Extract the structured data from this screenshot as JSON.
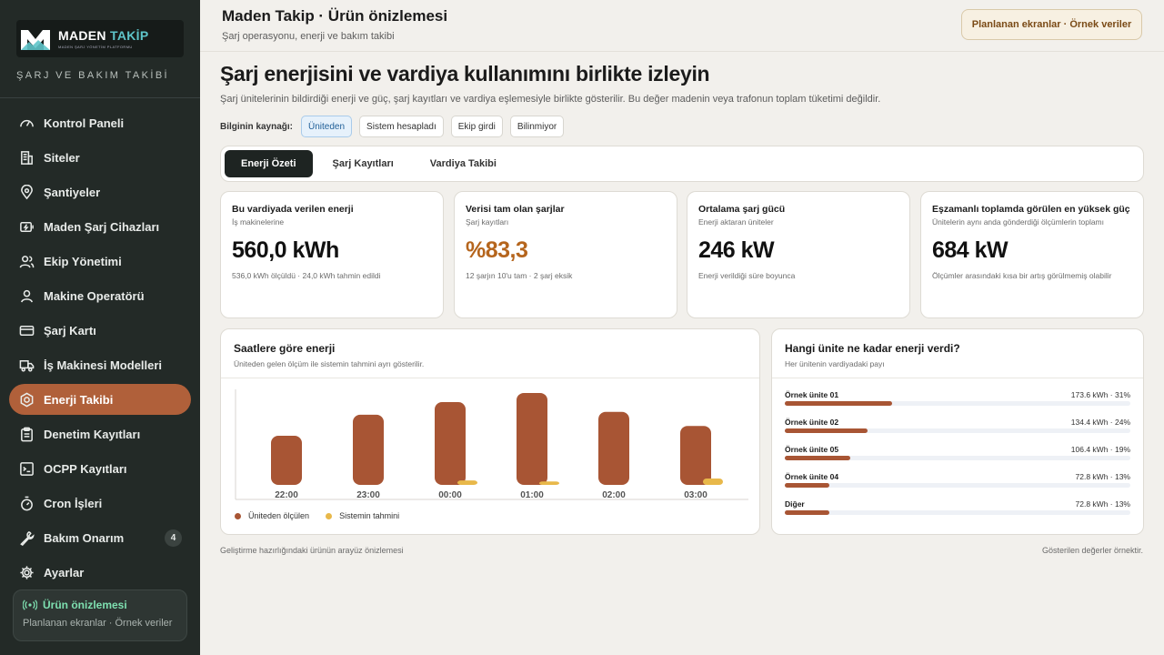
{
  "sidebar": {
    "logo_main": "MADEN",
    "logo_accent": "TAKİP",
    "logo_tagline": "MADEN ŞARJ YÖNETİM PLATFORMU",
    "subtitle": "ŞARJ VE BAKIM TAKİBİ",
    "items": [
      {
        "label": "Kontrol Paneli",
        "icon": "dashboard-icon"
      },
      {
        "label": "Siteler",
        "icon": "building-icon"
      },
      {
        "label": "Şantiyeler",
        "icon": "location-pin-icon"
      },
      {
        "label": "Maden Şarj Cihazları",
        "icon": "battery-charge-icon"
      },
      {
        "label": "Ekip Yönetimi",
        "icon": "team-icon"
      },
      {
        "label": "Makine Operatörü",
        "icon": "user-icon"
      },
      {
        "label": "Şarj Kartı",
        "icon": "card-icon"
      },
      {
        "label": "İş Makinesi Modelleri",
        "icon": "truck-icon"
      },
      {
        "label": "Enerji Takibi",
        "icon": "energy-hex-icon",
        "active": true
      },
      {
        "label": "Denetim Kayıtları",
        "icon": "clipboard-icon"
      },
      {
        "label": "OCPP Kayıtları",
        "icon": "terminal-icon"
      },
      {
        "label": "Cron İşleri",
        "icon": "stopwatch-icon"
      },
      {
        "label": "Bakım Onarım",
        "icon": "wrench-icon",
        "badge": "4"
      },
      {
        "label": "Ayarlar",
        "icon": "gear-icon"
      }
    ],
    "preview": {
      "title": "Ürün önizlemesi",
      "sub": "Planlanan ekranlar · Örnek veriler"
    }
  },
  "header": {
    "title": "Maden Takip · Ürün önizlemesi",
    "subtitle": "Şarj operasyonu, enerji ve bakım takibi",
    "pill": "Planlanan ekranlar · Örnek veriler"
  },
  "main": {
    "title": "Şarj enerjisini ve vardiya kullanımını birlikte izleyin",
    "description": "Şarj ünitelerinin bildirdiği enerji ve güç, şarj kayıtları ve vardiya eşlemesiyle birlikte gösterilir. Bu değer madenin veya trafonun toplam tüketimi değildir.",
    "source_label": "Bilginin kaynağı:",
    "sources": [
      "Üniteden",
      "Sistem hesapladı",
      "Ekip girdi",
      "Bilinmiyor"
    ],
    "tabs": [
      "Enerji Özeti",
      "Şarj Kayıtları",
      "Vardiya Takibi"
    ]
  },
  "kpis": [
    {
      "title": "Bu vardiyada verilen enerji",
      "sub": "İş makinelerine",
      "value": "560,0 kWh",
      "note": "536,0 kWh ölçüldü · 24,0 kWh tahmin edildi"
    },
    {
      "title": "Verisi tam olan şarjlar",
      "sub": "Şarj kayıtları",
      "value": "%83,3",
      "note": "12 şarjın 10'u tam · 2 şarj eksik"
    },
    {
      "title": "Ortalama şarj gücü",
      "sub": "Enerji aktaran üniteler",
      "value": "246 kW",
      "note": "Enerji verildiği süre boyunca"
    },
    {
      "title": "Eşzamanlı toplamda görülen en yüksek güç",
      "sub": "Ünitelerin aynı anda gönderdiği ölçümlerin toplamı",
      "value": "684 kW",
      "note": "Ölçümler arasındaki kısa bir artış görülmemiş olabilir"
    }
  ],
  "energy_panel": {
    "title": "Saatlere göre enerji",
    "sub": "Üniteden gelen ölçüm ile sistemin tahmini ayrı gösterilir.",
    "legend_measured": "Üniteden ölçülen",
    "legend_estimated": "Sistemin tahmini"
  },
  "units_panel": {
    "title": "Hangi ünite ne kadar enerji verdi?",
    "sub": "Her ünitenin vardiyadaki payı",
    "rows": [
      {
        "name": "Örnek ünite 01",
        "value": "173.6 kWh · 31%",
        "share": 0.31
      },
      {
        "name": "Örnek ünite 02",
        "value": "134.4 kWh · 24%",
        "share": 0.24
      },
      {
        "name": "Örnek ünite 05",
        "value": "106.4 kWh · 19%",
        "share": 0.19
      },
      {
        "name": "Örnek ünite 04",
        "value": "72.8 kWh · 13%",
        "share": 0.13
      },
      {
        "name": "Diğer",
        "value": "72.8 kWh · 13%",
        "share": 0.13
      }
    ]
  },
  "footer": {
    "left": "Geliştirme hazırlığındaki ürünün arayüz önizlemesi",
    "right": "Gösterilen değerler örnektir."
  },
  "colors": {
    "accent": "#b0603a",
    "measured": "#a85534",
    "estimated": "#e8b84a",
    "sidebar": "#232a27"
  },
  "chart_data": {
    "type": "bar",
    "categories": [
      "22:00",
      "23:00",
      "00:00",
      "01:00",
      "02:00",
      "03:00"
    ],
    "series": [
      {
        "name": "Üniteden ölçülen",
        "values": [
          70,
          100,
          118,
          131,
          104,
          84
        ]
      },
      {
        "name": "Sistemin tahmini",
        "values": [
          0,
          0,
          9,
          7,
          0,
          13
        ]
      }
    ],
    "ylim": [
      0,
      140
    ],
    "grid": false,
    "legend": "bottom-left"
  }
}
